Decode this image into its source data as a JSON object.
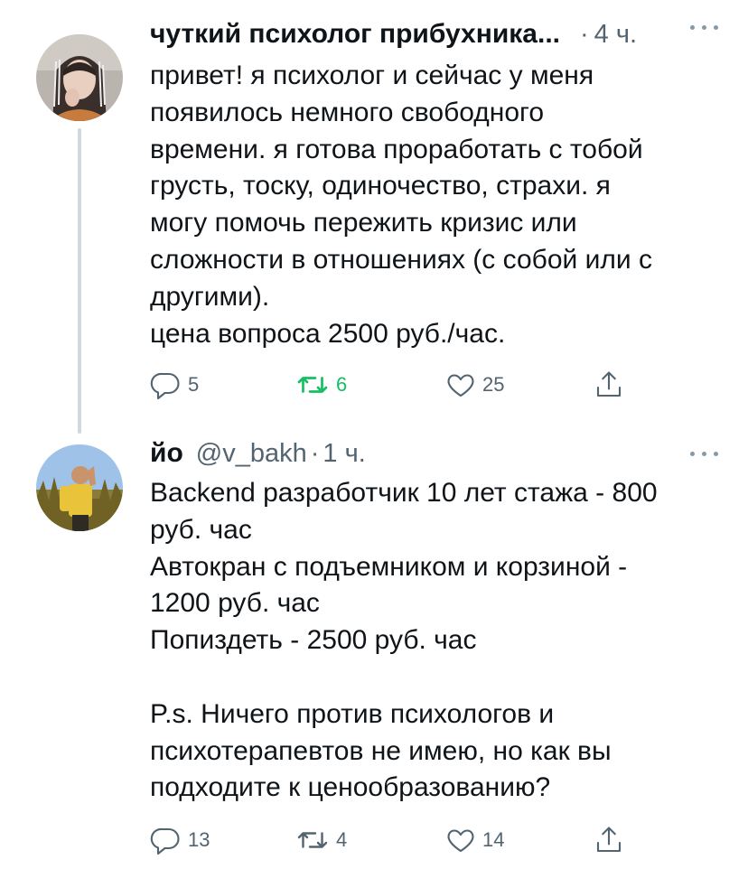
{
  "tweets": [
    {
      "author": "чуткий психолог прибухника...",
      "separator": "·",
      "time": "4 ч.",
      "text": "привет! я психолог и сейчас у меня\nпоявилось немного свободного\nвремени. я готова проработать с тобой\nгрусть, тоску, одиночество, страхи. я\nмогу помочь пережить кризис или\nсложности в отношениях (с собой или с\nдругими).\nцена вопроса 2500 руб./час.",
      "replies": "5",
      "retweets": "6",
      "likes": "25",
      "retweeted": true,
      "avatar_icon": "avatar-photo-woman"
    },
    {
      "author": "йо",
      "handle": "@v_bakh",
      "separator": "·",
      "time": "1 ч.",
      "text": "Backend разработчик 10 лет стажа - 800\nруб. час\nАвтокран с подъемником и корзиной -\n1200 руб. час\nПопиздеть - 2500 руб. час\n\nP.s. Ничего против психологов и\nпсихотерапевтов не имею, но как вы\nподходите к ценообразованию?",
      "replies": "13",
      "retweets": "4",
      "likes": "14",
      "retweeted": false,
      "avatar_icon": "avatar-photo-man"
    }
  ],
  "colors": {
    "text": "#0f1419",
    "secondary": "#536471",
    "retweet_active": "#17bf63",
    "thread_line": "#cfd9de"
  },
  "icons": [
    "reply-icon",
    "retweet-icon",
    "like-icon",
    "share-icon",
    "more-icon"
  ]
}
